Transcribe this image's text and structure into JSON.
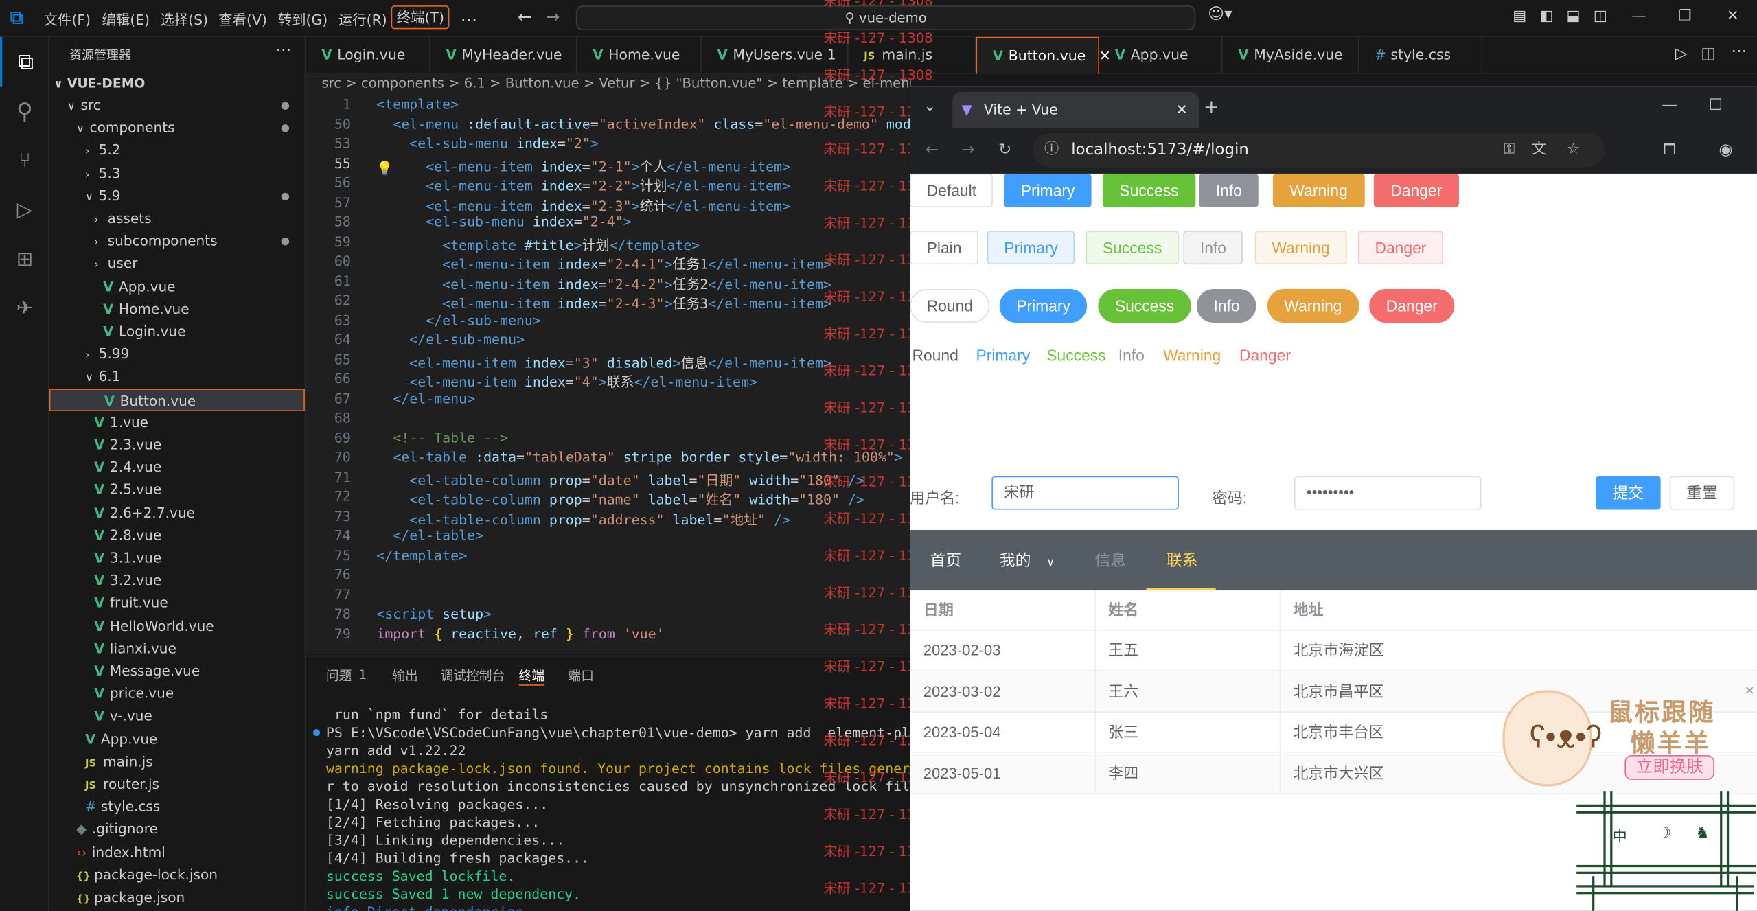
{
  "titlebar": {
    "menus": [
      "文件(F)",
      "编辑(E)",
      "选择(S)",
      "查看(V)",
      "转到(G)",
      "运行(R)",
      "终端(T)"
    ],
    "search_text": "vue-demo"
  },
  "sidebar": {
    "title": "资源管理器",
    "root": "VUE-DEMO",
    "items": [
      {
        "label": "src",
        "kind": "folder-open",
        "depth": 1,
        "dot": true
      },
      {
        "label": "components",
        "kind": "folder-open",
        "depth": 2,
        "dot": true
      },
      {
        "label": "5.2",
        "kind": "folder",
        "depth": 3
      },
      {
        "label": "5.3",
        "kind": "folder",
        "depth": 3
      },
      {
        "label": "5.9",
        "kind": "folder-open",
        "depth": 3,
        "dot": true
      },
      {
        "label": "assets",
        "kind": "folder",
        "depth": 4
      },
      {
        "label": "subcomponents",
        "kind": "folder",
        "depth": 4,
        "dot": true
      },
      {
        "label": "user",
        "kind": "folder",
        "depth": 4
      },
      {
        "label": "App.vue",
        "kind": "vue",
        "depth": 4
      },
      {
        "label": "Home.vue",
        "kind": "vue",
        "depth": 4
      },
      {
        "label": "Login.vue",
        "kind": "vue",
        "depth": 4
      },
      {
        "label": "5.99",
        "kind": "folder",
        "depth": 3
      },
      {
        "label": "6.1",
        "kind": "folder-open",
        "depth": 3
      },
      {
        "label": "Button.vue",
        "kind": "vue",
        "depth": 4,
        "selected": true
      },
      {
        "label": "1.vue",
        "kind": "vue",
        "depth": 3
      },
      {
        "label": "2.3.vue",
        "kind": "vue",
        "depth": 3
      },
      {
        "label": "2.4.vue",
        "kind": "vue",
        "depth": 3
      },
      {
        "label": "2.5.vue",
        "kind": "vue",
        "depth": 3
      },
      {
        "label": "2.6+2.7.vue",
        "kind": "vue",
        "depth": 3
      },
      {
        "label": "2.8.vue",
        "kind": "vue",
        "depth": 3
      },
      {
        "label": "3.1.vue",
        "kind": "vue",
        "depth": 3
      },
      {
        "label": "3.2.vue",
        "kind": "vue",
        "depth": 3
      },
      {
        "label": "fruit.vue",
        "kind": "vue",
        "depth": 3
      },
      {
        "label": "HelloWorld.vue",
        "kind": "vue",
        "depth": 3
      },
      {
        "label": "lianxi.vue",
        "kind": "vue",
        "depth": 3
      },
      {
        "label": "Message.vue",
        "kind": "vue",
        "depth": 3
      },
      {
        "label": "price.vue",
        "kind": "vue",
        "depth": 3
      },
      {
        "label": "v-.vue",
        "kind": "vue",
        "depth": 3
      },
      {
        "label": "App.vue",
        "kind": "vue",
        "depth": 2
      },
      {
        "label": "main.js",
        "kind": "js",
        "depth": 2
      },
      {
        "label": "router.js",
        "kind": "js",
        "depth": 2
      },
      {
        "label": "style.css",
        "kind": "css",
        "depth": 2
      },
      {
        "label": ".gitignore",
        "kind": "git",
        "depth": 1
      },
      {
        "label": "index.html",
        "kind": "html",
        "depth": 1
      },
      {
        "label": "package-lock.json",
        "kind": "json",
        "depth": 1
      },
      {
        "label": "package.json",
        "kind": "json",
        "depth": 1
      }
    ]
  },
  "tabs": [
    {
      "label": "Login.vue",
      "kind": "vue"
    },
    {
      "label": "MyHeader.vue",
      "kind": "vue"
    },
    {
      "label": "Home.vue",
      "kind": "vue"
    },
    {
      "label": "MyUsers.vue 1",
      "kind": "vue"
    },
    {
      "label": "main.js",
      "kind": "js"
    },
    {
      "label": "Button.vue",
      "kind": "vue",
      "active": true
    },
    {
      "label": "App.vue",
      "kind": "vue"
    },
    {
      "label": "MyAside.vue",
      "kind": "vue"
    },
    {
      "label": "style.css",
      "kind": "css"
    }
  ],
  "breadcrumb": "src > components > 6.1 > Button.vue > Vetur > {} \"Button.vue\" > template > el-menu.el-menu-demo > el-sub-menu > el-menu-item",
  "editor": {
    "lines": [
      {
        "n": "1",
        "html": "<span class='t'>&lt;template&gt;</span>"
      },
      {
        "n": "50",
        "html": "  <span class='t'>&lt;el-menu</span> <span class='a'>:default-active</span>=<span class='s'>\"activeIndex\"</span> <span class='a'>class</span>=<span class='s'>\"el-menu-demo\"</span> <span class='a'>mode</span>="
      },
      {
        "n": "53",
        "html": "    <span class='t'>&lt;el-sub-menu</span> <span class='a'>index</span>=<span class='s'>\"2\"</span><span class='t'>&gt;</span>"
      },
      {
        "n": "55",
        "html": "      <span class='t'>&lt;el-menu-item</span> <span class='a'>index</span>=<span class='s'>\"2-1\"</span><span class='t'>&gt;</span>个人<span class='t'>&lt;/el-menu-item&gt;</span>",
        "cur": true
      },
      {
        "n": "56",
        "html": "      <span class='t'>&lt;el-menu-item</span> <span class='a'>index</span>=<span class='s'>\"2-2\"</span><span class='t'>&gt;</span>计划<span class='t'>&lt;/el-menu-item&gt;</span>"
      },
      {
        "n": "57",
        "html": "      <span class='t'>&lt;el-menu-item</span> <span class='a'>index</span>=<span class='s'>\"2-3\"</span><span class='t'>&gt;</span>统计<span class='t'>&lt;/el-menu-item&gt;</span>"
      },
      {
        "n": "58",
        "html": "      <span class='t'>&lt;el-sub-menu</span> <span class='a'>index</span>=<span class='s'>\"2-4\"</span><span class='t'>&gt;</span>"
      },
      {
        "n": "59",
        "html": "        <span class='t'>&lt;template</span> <span class='a'>#title</span><span class='t'>&gt;</span>计划<span class='t'>&lt;/template&gt;</span>"
      },
      {
        "n": "60",
        "html": "        <span class='t'>&lt;el-menu-item</span> <span class='a'>index</span>=<span class='s'>\"2-4-1\"</span><span class='t'>&gt;</span>任务1<span class='t'>&lt;/el-menu-item&gt;</span>"
      },
      {
        "n": "61",
        "html": "        <span class='t'>&lt;el-menu-item</span> <span class='a'>index</span>=<span class='s'>\"2-4-2\"</span><span class='t'>&gt;</span>任务2<span class='t'>&lt;/el-menu-item&gt;</span>"
      },
      {
        "n": "62",
        "html": "        <span class='t'>&lt;el-menu-item</span> <span class='a'>index</span>=<span class='s'>\"2-4-3\"</span><span class='t'>&gt;</span>任务3<span class='t'>&lt;/el-menu-item&gt;</span>"
      },
      {
        "n": "63",
        "html": "      <span class='t'>&lt;/el-sub-menu&gt;</span>"
      },
      {
        "n": "64",
        "html": "    <span class='t'>&lt;/el-sub-menu&gt;</span>"
      },
      {
        "n": "65",
        "html": "    <span class='t'>&lt;el-menu-item</span> <span class='a'>index</span>=<span class='s'>\"3\"</span> <span class='a'>disabled</span><span class='t'>&gt;</span>信息<span class='t'>&lt;/el-menu-item&gt;</span>"
      },
      {
        "n": "66",
        "html": "    <span class='t'>&lt;el-menu-item</span> <span class='a'>index</span>=<span class='s'>\"4\"</span><span class='t'>&gt;</span>联系<span class='t'>&lt;/el-menu-item&gt;</span>"
      },
      {
        "n": "67",
        "html": "  <span class='t'>&lt;/el-menu&gt;</span>"
      },
      {
        "n": "68",
        "html": ""
      },
      {
        "n": "69",
        "html": "  <span class='c'>&lt;!-- Table --&gt;</span>"
      },
      {
        "n": "70",
        "html": "  <span class='t'>&lt;el-table</span> <span class='a'>:data</span>=<span class='s'>\"tableData\"</span> <span class='a'>stripe</span> <span class='a'>border</span> <span class='a'>style</span>=<span class='s'>\"width: 100%\"</span><span class='t'>&gt;</span>"
      },
      {
        "n": "71",
        "html": "    <span class='t'>&lt;el-table-column</span> <span class='a'>prop</span>=<span class='s'>\"date\"</span> <span class='a'>label</span>=<span class='s'>\"日期\"</span> <span class='a'>width</span>=<span class='s'>\"180\"</span> <span class='t'>/&gt;</span>"
      },
      {
        "n": "72",
        "html": "    <span class='t'>&lt;el-table-column</span> <span class='a'>prop</span>=<span class='s'>\"name\"</span> <span class='a'>label</span>=<span class='s'>\"姓名\"</span> <span class='a'>width</span>=<span class='s'>\"180\"</span> <span class='t'>/&gt;</span>"
      },
      {
        "n": "73",
        "html": "    <span class='t'>&lt;el-table-column</span> <span class='a'>prop</span>=<span class='s'>\"address\"</span> <span class='a'>label</span>=<span class='s'>\"地址\"</span> <span class='t'>/&gt;</span>"
      },
      {
        "n": "74",
        "html": "  <span class='t'>&lt;/el-table&gt;</span>"
      },
      {
        "n": "75",
        "html": "<span class='t'>&lt;/template&gt;</span>"
      },
      {
        "n": "76",
        "html": ""
      },
      {
        "n": "77",
        "html": ""
      },
      {
        "n": "78",
        "html": "<span class='t'>&lt;script</span> <span class='a'>setup</span><span class='t'>&gt;</span>"
      },
      {
        "n": "79",
        "html": "<span class='k'>import</span> <span class='b'>{</span> <span class='a'>reactive</span>, <span class='a'>ref</span> <span class='b'>}</span> <span class='k'>from</span> <span class='s'>'vue'</span>"
      }
    ]
  },
  "panel": {
    "tabs": [
      "问题",
      "输出",
      "调试控制台",
      "终端",
      "端口"
    ],
    "problems_count": "1",
    "terminal_lines": [
      {
        "text": " run `npm fund` for details",
        "color": "#cccccc"
      },
      {
        "text": "PS E:\\VScode\\VSCodeCunFang\\vue\\chapter01\\vue-demo> yarn add  element-plus --s",
        "color": "#cccccc"
      },
      {
        "text": "yarn add v1.22.22",
        "color": "#cccccc"
      },
      {
        "text": "warning package-lock.json found. Your project contains lock files generated b",
        "color": "#cccccc"
      },
      {
        "text": "r to avoid resolution inconsistencies caused by unsynchronized lock files. To",
        "color": "#cccccc"
      },
      {
        "text": "[1/4] Resolving packages...",
        "color": "#cccccc"
      },
      {
        "text": "[2/4] Fetching packages...",
        "color": "#cccccc"
      },
      {
        "text": "[3/4] Linking dependencies...",
        "color": "#cccccc"
      },
      {
        "text": "[4/4] Building fresh packages...",
        "color": "#cccccc"
      },
      {
        "text": "success Saved lockfile.",
        "color": "#cccccc"
      },
      {
        "text": "success Saved 1 new dependency.",
        "color": "#cccccc"
      },
      {
        "text": "info Direct dependencies",
        "color": "#cccccc"
      }
    ]
  },
  "watermark": "宋研 -127 - 1308",
  "browser": {
    "tab_title": "Vite + Vue",
    "url": "localhost:5173/#/login",
    "buttons_row1": [
      {
        "label": "Default",
        "style": "default"
      },
      {
        "label": "Primary",
        "style": "primary"
      },
      {
        "label": "Success",
        "style": "success"
      },
      {
        "label": "Info",
        "style": "info"
      },
      {
        "label": "Warning",
        "style": "warning"
      },
      {
        "label": "Danger",
        "style": "danger"
      }
    ],
    "buttons_row2": [
      {
        "label": "Plain",
        "style": "default"
      },
      {
        "label": "Primary",
        "style": "primary"
      },
      {
        "label": "Success",
        "style": "success"
      },
      {
        "label": "Info",
        "style": "info"
      },
      {
        "label": "Warning",
        "style": "warning"
      },
      {
        "label": "Danger",
        "style": "danger"
      }
    ],
    "buttons_row3": [
      {
        "label": "Round",
        "style": "default"
      },
      {
        "label": "Primary",
        "style": "primary"
      },
      {
        "label": "Success",
        "style": "success"
      },
      {
        "label": "Info",
        "style": "info"
      },
      {
        "label": "Warning",
        "style": "warning"
      },
      {
        "label": "Danger",
        "style": "danger"
      }
    ],
    "buttons_row4": [
      {
        "label": "Round",
        "style": "default"
      },
      {
        "label": "Primary",
        "style": "primary"
      },
      {
        "label": "Success",
        "style": "success"
      },
      {
        "label": "Info",
        "style": "info"
      },
      {
        "label": "Warning",
        "style": "warning"
      },
      {
        "label": "Danger",
        "style": "danger"
      }
    ],
    "form": {
      "username_label": "用户名:",
      "username_value": "宋研",
      "password_label": "密码:",
      "password_value": "•••••••••",
      "submit": "提交",
      "reset": "重置"
    },
    "nav": {
      "items": [
        "首页",
        "我的",
        "信息",
        "联系"
      ],
      "active": "联系",
      "disabled": "信息"
    },
    "table": {
      "headers": [
        "日期",
        "姓名",
        "地址"
      ],
      "rows": [
        [
          "2023-02-03",
          "王五",
          "北京市海淀区"
        ],
        [
          "2023-03-02",
          "王六",
          "北京市昌平区"
        ],
        [
          "2023-05-04",
          "张三",
          "北京市丰台区"
        ],
        [
          "2023-05-01",
          "李四",
          "北京市大兴区"
        ]
      ]
    },
    "ad": {
      "line1": "鼠标跟随",
      "line2": "懒羊羊",
      "button": "立即换肤",
      "widget": [
        "中",
        "☽",
        "♞"
      ]
    }
  },
  "colors": {
    "primary": "#409eff",
    "success": "#67c23a",
    "info": "#909399",
    "warning": "#e6a23c",
    "danger": "#f56c6c",
    "accent": "#e8661d",
    "nav_bg": "#545c64",
    "nav_active": "#ffd04b"
  }
}
